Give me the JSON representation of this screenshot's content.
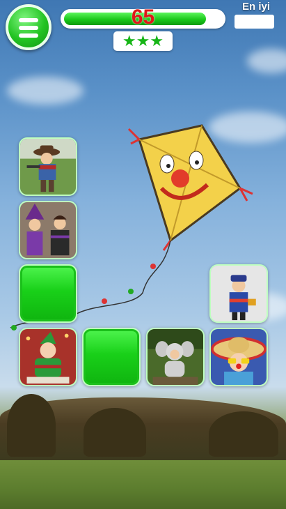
{
  "header": {
    "timer_value": "65",
    "timer_fraction": 0.9,
    "stars_filled": 3,
    "stars_display": "★★★",
    "best_label": "En iyi",
    "best_value": ""
  },
  "colors": {
    "accent_green": "#17c417",
    "timer_red": "#e01818"
  },
  "menu_icon": "hamburger-menu-icon",
  "board": {
    "tiles": [
      {
        "id": "t-r1c1",
        "state": "revealed",
        "image": "cowboy-child-photo"
      },
      {
        "id": "t-r2c1",
        "state": "revealed",
        "image": "witch-costume-girls-photo"
      },
      {
        "id": "t-r3c1",
        "state": "hidden",
        "image": ""
      },
      {
        "id": "t-r3c4",
        "state": "revealed",
        "image": "child-traditional-costume-photo"
      },
      {
        "id": "t-r4c1",
        "state": "revealed",
        "image": "elf-baby-photo"
      },
      {
        "id": "t-r4c2",
        "state": "hidden",
        "image": ""
      },
      {
        "id": "t-r4c3",
        "state": "revealed",
        "image": "elephant-costume-baby-photo"
      },
      {
        "id": "t-r4c4",
        "state": "revealed",
        "image": "sombrero-baby-photo"
      }
    ]
  }
}
